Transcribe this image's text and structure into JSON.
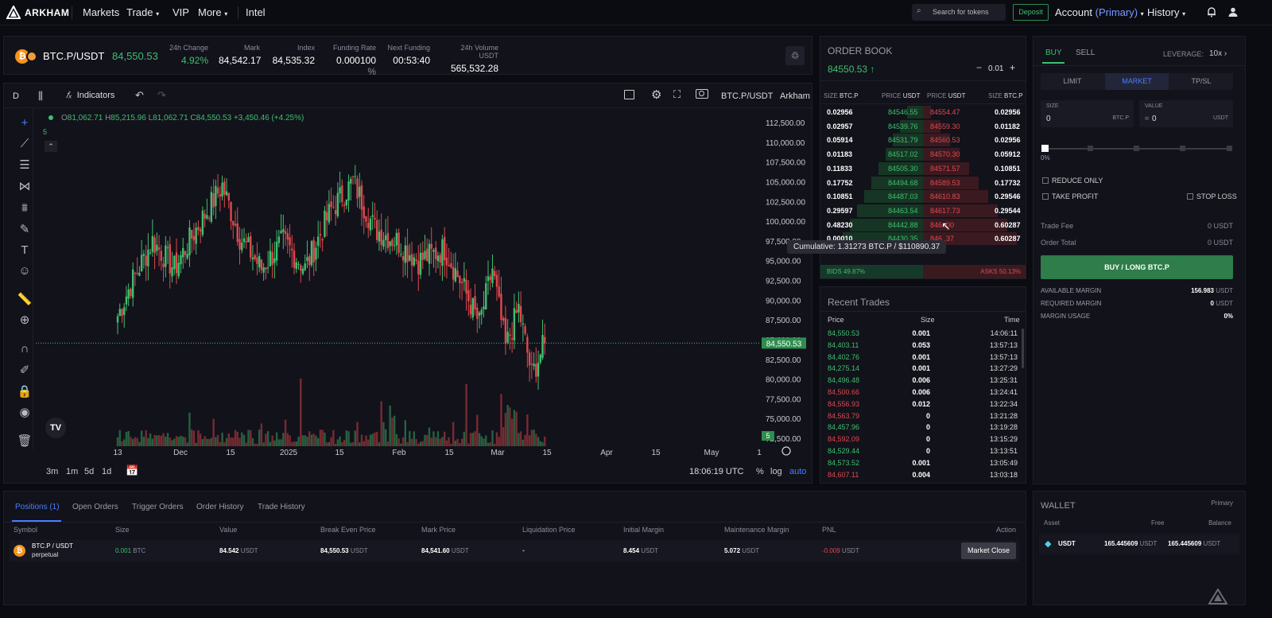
{
  "brand": {
    "name": "ARKHAM"
  },
  "nav": {
    "markets": "Markets",
    "trade": "Trade",
    "vip": "VIP",
    "more": "More",
    "intel": "Intel",
    "search_placeholder": "Search for tokens",
    "deposit": "Deposit",
    "account": "Account",
    "account_type": "(Primary)",
    "history": "History"
  },
  "ticker": {
    "pair": "BTC.P/USDT",
    "price": "84,550.53",
    "stats": [
      {
        "label": "24h Change",
        "value": "4.92%"
      },
      {
        "label": "Mark",
        "value": "84,542.17"
      },
      {
        "label": "Index",
        "value": "84,535.32"
      },
      {
        "label": "Funding Rate",
        "value": "0.000100",
        "unit": "%"
      },
      {
        "label": "Next Funding",
        "value": "00:53:40"
      },
      {
        "label": "24h Volume USDT",
        "value": "565,532.28"
      }
    ]
  },
  "chart": {
    "interval": "D",
    "indicators": "Indicators",
    "symbol": "BTC.P/USDT",
    "source": "Arkham",
    "ohlc": {
      "o_label": "O",
      "o": "81,062.71",
      "h_label": "H",
      "h": "85,215.96",
      "l_label": "L",
      "l": "81,062.71",
      "c_label": "C",
      "c": "84,550.53",
      "chg": "+3,450.46 (+4.25%)"
    },
    "vol_label": "5",
    "last_price_tag": "84,550.53",
    "vol_tag": "5",
    "time": "18:06:19 UTC",
    "pct": "%",
    "log": "log",
    "auto": "auto",
    "ranges": [
      "3m",
      "1m",
      "5d",
      "1d"
    ]
  },
  "chart_data": {
    "type": "candlestick",
    "x_ticks": [
      "13",
      "Dec",
      "15",
      "2025",
      "15",
      "Feb",
      "15",
      "Mar",
      "15",
      "Apr",
      "15",
      "May",
      "1"
    ],
    "y_ticks": [
      "112,500.00",
      "110,000.00",
      "107,500.00",
      "105,000.00",
      "102,500.00",
      "100,000.00",
      "97,500.00",
      "95,000.00",
      "92,500.00",
      "90,000.00",
      "87,500.00",
      "85,000.00",
      "82,500.00",
      "80,000.00",
      "77,500.00",
      "75,000.00",
      "72,500.00"
    ],
    "ylim": [
      72500,
      112500
    ],
    "last_close": 84550.53,
    "theme": {
      "up": "#3fbf6e",
      "down": "#e0484d"
    }
  },
  "orderbook": {
    "title": "ORDER BOOK",
    "mid": "84550.53 ↑",
    "tick": "0.01",
    "plus": "+",
    "headers": {
      "size": "SIZE",
      "size_unit": "BTC.P",
      "price": "PRICE",
      "price_unit": "USDT"
    },
    "rows": [
      {
        "bsize": "0.02956",
        "bprice": "84546.55",
        "aprice": "84554.47",
        "asize": "0.02956"
      },
      {
        "bsize": "0.02957",
        "bprice": "84539.76",
        "aprice": "84559.30",
        "asize": "0.01182"
      },
      {
        "bsize": "0.05914",
        "bprice": "84531.79",
        "aprice": "84560.53",
        "asize": "0.02956"
      },
      {
        "bsize": "0.01183",
        "bprice": "84517.02",
        "aprice": "84570.30",
        "asize": "0.05912"
      },
      {
        "bsize": "0.11833",
        "bprice": "84505.30",
        "aprice": "84571.57",
        "asize": "0.10851"
      },
      {
        "bsize": "0.17752",
        "bprice": "84494.68",
        "aprice": "84589.53",
        "asize": "0.17732"
      },
      {
        "bsize": "0.10851",
        "bprice": "84487.03",
        "aprice": "84610.83",
        "asize": "0.29546"
      },
      {
        "bsize": "0.29597",
        "bprice": "84463.54",
        "aprice": "84617.73",
        "asize": "0.29544"
      },
      {
        "bsize": "0.48230",
        "bprice": "84442.88",
        "aprice": "846..00",
        "asize": "0.60287"
      },
      {
        "bsize": "0.00010",
        "bprice": "84430.35",
        "aprice": "846..37",
        "asize": "0.60287"
      }
    ],
    "tooltip": "Cumulative: 1.31273 BTC.P / $110890.37",
    "bids": "BIDS 49.87%",
    "asks": "ASKS 50.13%",
    "bid_ratio": 0.4987
  },
  "trades": {
    "title": "Recent Trades",
    "h_price": "Price",
    "h_size": "Size",
    "h_time": "Time",
    "rows": [
      {
        "p": "84,550.53",
        "s": "0.001",
        "t": "14:06:11",
        "side": "buy"
      },
      {
        "p": "84,403.11",
        "s": "0.053",
        "t": "13:57:13",
        "side": "buy"
      },
      {
        "p": "84,402.76",
        "s": "0.001",
        "t": "13:57:13",
        "side": "buy"
      },
      {
        "p": "84,275.14",
        "s": "0.001",
        "t": "13:27:29",
        "side": "buy"
      },
      {
        "p": "84,496.48",
        "s": "0.006",
        "t": "13:25:31",
        "side": "buy"
      },
      {
        "p": "84,500.66",
        "s": "0.006",
        "t": "13:24:41",
        "side": "sell"
      },
      {
        "p": "84,556.93",
        "s": "0.012",
        "t": "13:22:34",
        "side": "sell"
      },
      {
        "p": "84,563.79",
        "s": "0",
        "t": "13:21:28",
        "side": "sell"
      },
      {
        "p": "84,457.96",
        "s": "0",
        "t": "13:19:28",
        "side": "buy"
      },
      {
        "p": "84,592.09",
        "s": "0",
        "t": "13:15:29",
        "side": "sell"
      },
      {
        "p": "84,529.44",
        "s": "0",
        "t": "13:13:51",
        "side": "buy"
      },
      {
        "p": "84,573.52",
        "s": "0.001",
        "t": "13:05:49",
        "side": "buy"
      },
      {
        "p": "84,607.11",
        "s": "0.004",
        "t": "13:03:18",
        "side": "sell"
      }
    ]
  },
  "order_form": {
    "buy": "BUY",
    "sell": "SELL",
    "leverage_label": "LEVERAGE:",
    "leverage": "10x",
    "types": [
      "LIMIT",
      "MARKET",
      "TP/SL"
    ],
    "size_label": "SIZE",
    "size_value": "0",
    "size_unit": "BTC.P",
    "value_label": "VALUE",
    "value_prefix": "≈",
    "value_value": "0",
    "value_unit": "USDT",
    "slider_pct": "0%",
    "reduce_only": "REDUCE ONLY",
    "take_profit": "TAKE PROFIT",
    "stop_loss": "STOP LOSS",
    "trade_fee_label": "Trade Fee",
    "trade_fee": "0 USDT",
    "order_total_label": "Order Total",
    "order_total": "0 USDT",
    "submit": "BUY / LONG BTC.P",
    "available_label": "AVAILABLE MARGIN",
    "available": "156.983",
    "available_unit": "USDT",
    "required_label": "REQUIRED MARGIN",
    "required": "0",
    "required_unit": "USDT",
    "usage_label": "MARGIN USAGE",
    "usage": "0%"
  },
  "positions": {
    "tabs": [
      "Positions (1)",
      "Open Orders",
      "Trigger Orders",
      "Order History",
      "Trade History"
    ],
    "headers": [
      "Symbol",
      "Size",
      "Value",
      "Break Even Price",
      "Mark Price",
      "Liquidation Price",
      "Initial Margin",
      "Maintenance Margin",
      "PNL",
      "Action"
    ],
    "row": {
      "symbol": "BTC.P / USDT",
      "symbol_sub": "perpetual",
      "size": "0.001",
      "size_unit": "BTC",
      "value": "84.542",
      "value_unit": "USDT",
      "bep": "84,550.53",
      "bep_unit": "USDT",
      "mark": "84,541.60",
      "mark_unit": "USDT",
      "liq": "-",
      "im": "8.454",
      "im_unit": "USDT",
      "mm": "5.072",
      "mm_unit": "USDT",
      "pnl": "-0.009",
      "pnl_unit": "USDT",
      "action": "Market Close"
    }
  },
  "wallet": {
    "title": "WALLET",
    "type": "Primary",
    "h_asset": "Asset",
    "h_free": "Free",
    "h_balance": "Balance",
    "asset": "USDT",
    "free": "165.445609",
    "free_unit": "USDT",
    "balance": "165.445609",
    "balance_unit": "USDT"
  }
}
